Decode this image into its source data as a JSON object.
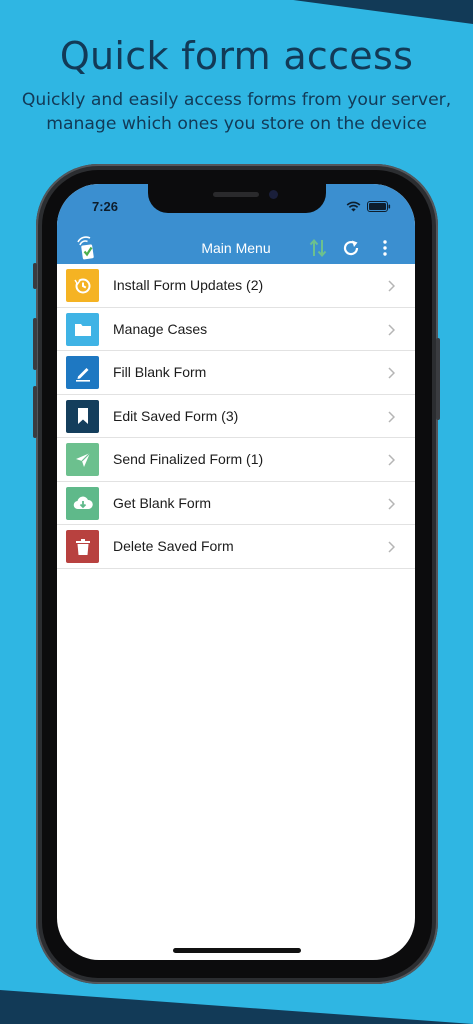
{
  "headline": "Quick form access",
  "subtitle_lines": [
    "Quickly and easily access forms from your server,",
    "manage which ones you store on the device"
  ],
  "status_bar": {
    "time": "7:26"
  },
  "nav": {
    "title": "Main Menu"
  },
  "menu": [
    {
      "label": "Install Form Updates (2)",
      "icon": "update-icon",
      "color": "#f5b323"
    },
    {
      "label": "Manage Cases",
      "icon": "folder-icon",
      "color": "#3fb3e5"
    },
    {
      "label": "Fill Blank Form",
      "icon": "pencil-icon",
      "color": "#1e78c2"
    },
    {
      "label": "Edit Saved Form (3)",
      "icon": "bookmark-icon",
      "color": "#143e5c"
    },
    {
      "label": "Send Finalized Form (1)",
      "icon": "send-icon",
      "color": "#6cc08e"
    },
    {
      "label": "Get Blank Form",
      "icon": "cloud-download-icon",
      "color": "#5fb98a"
    },
    {
      "label": "Delete Saved Form",
      "icon": "trash-icon",
      "color": "#b8413f"
    }
  ],
  "colors": {
    "background": "#2fb6e3",
    "brand_dark": "#123a57",
    "nav_bar": "#3b8fd0"
  }
}
